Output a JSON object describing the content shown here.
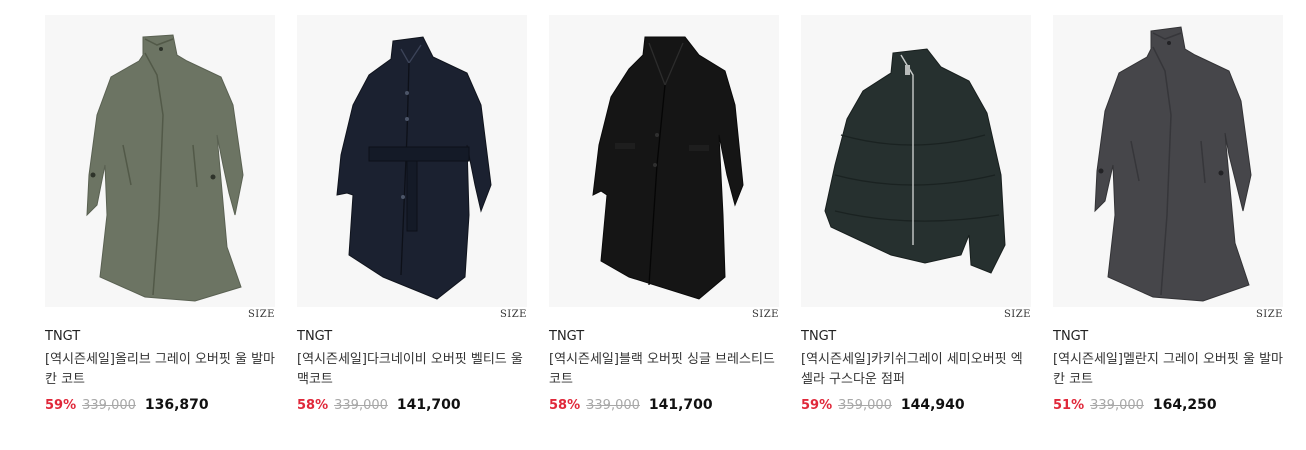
{
  "products": [
    {
      "brand": "TNGT",
      "name": "[역시즌세일]올리브 그레이 오버핏 울 발마칸 코트",
      "discount": "59%",
      "original_price": "339,000",
      "sale_price": "136,870",
      "size_label": "SIZE",
      "image_icon": "olive-balmacaan-coat-icon",
      "image_color": "#6c7463"
    },
    {
      "brand": "TNGT",
      "name": "[역시즌세일]다크네이비 오버핏 벨티드 울 맥코트",
      "discount": "58%",
      "original_price": "339,000",
      "sale_price": "141,700",
      "size_label": "SIZE",
      "image_icon": "navy-belted-mac-coat-icon",
      "image_color": "#1b2130"
    },
    {
      "brand": "TNGT",
      "name": "[역시즌세일]블랙 오버핏 싱글 브레스티드 코트",
      "discount": "58%",
      "original_price": "339,000",
      "sale_price": "141,700",
      "size_label": "SIZE",
      "image_icon": "black-single-breasted-coat-icon",
      "image_color": "#151515"
    },
    {
      "brand": "TNGT",
      "name": "[역시즌세일]카키쉬그레이 세미오버핏 엑셀라 구스다운 점퍼",
      "discount": "59%",
      "original_price": "359,000",
      "sale_price": "144,940",
      "size_label": "SIZE",
      "image_icon": "khaki-grey-down-jumper-icon",
      "image_color": "#26302f"
    },
    {
      "brand": "TNGT",
      "name": "[역시즌세일]멜란지 그레이 오버핏 울 발마칸 코트",
      "discount": "51%",
      "original_price": "339,000",
      "sale_price": "164,250",
      "size_label": "SIZE",
      "image_icon": "melange-grey-balmacaan-coat-icon",
      "image_color": "#46464a"
    }
  ],
  "colors": {
    "discount": "#e0283a",
    "original_price": "#a8a8a8",
    "sale_price": "#111111",
    "thumb_bg": "#f7f7f7"
  }
}
